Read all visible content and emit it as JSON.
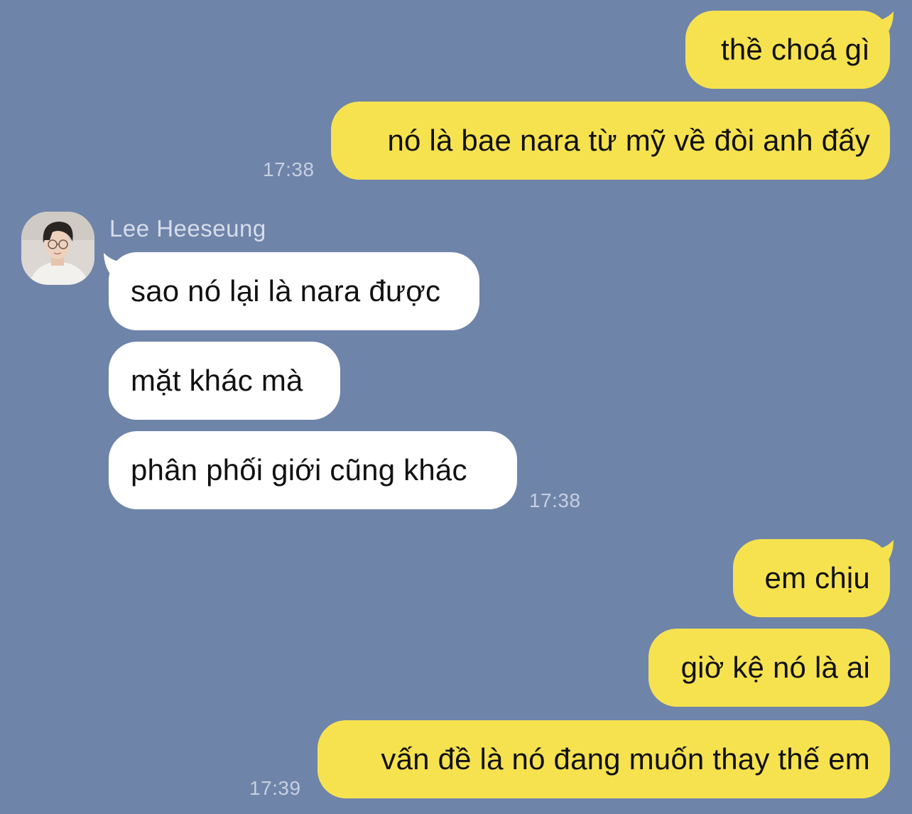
{
  "conversation": {
    "messages_group1": {
      "msg1": "thề choá gì",
      "msg2": "nó là bae nara từ mỹ về đòi anh đấy",
      "time": "17:38"
    },
    "contact": {
      "name": "Lee Heeseung",
      "msg1": "sao nó lại là nara được",
      "msg2": "mặt khác mà",
      "msg3": "phân phối giới cũng khác",
      "time": "17:38"
    },
    "messages_group2": {
      "msg1": "em chịu",
      "msg2": "giờ kệ nó là ai",
      "msg3": "vấn đề là nó đang muốn thay thế em",
      "time": "17:39"
    }
  },
  "colors": {
    "background": "#6f84a9",
    "outgoing_bubble": "#f6e24f",
    "incoming_bubble": "#ffffff",
    "timestamp": "#c6d0e0"
  }
}
